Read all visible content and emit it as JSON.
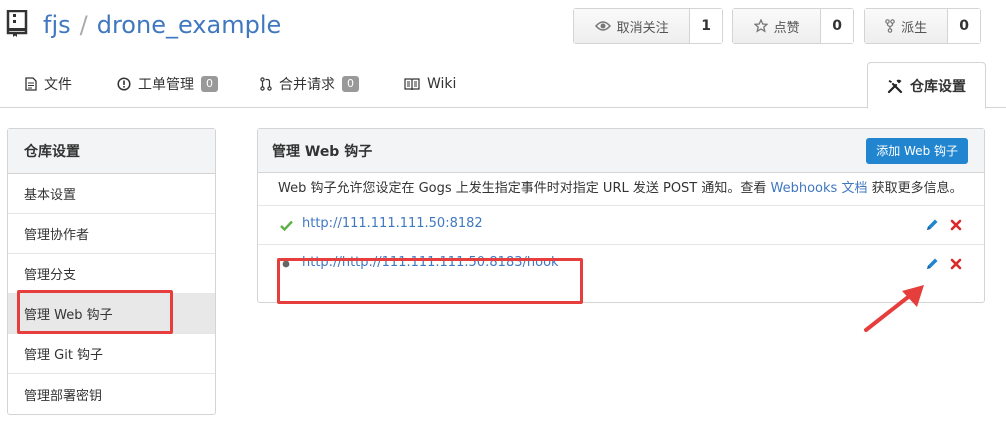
{
  "repo": {
    "owner": "fjs",
    "separator": "/",
    "name": "drone_example"
  },
  "actions": {
    "watch": {
      "label": "取消关注",
      "count": "1",
      "icon": "eye-icon"
    },
    "star": {
      "label": "点赞",
      "count": "0",
      "icon": "star-icon"
    },
    "fork": {
      "label": "派生",
      "count": "0",
      "icon": "fork-icon"
    }
  },
  "tabs": {
    "files": {
      "label": "文件",
      "icon": "file-icon"
    },
    "issues": {
      "label": "工单管理",
      "count": "0",
      "icon": "issue-icon"
    },
    "pulls": {
      "label": "合并请求",
      "count": "0",
      "icon": "pull-request-icon"
    },
    "wiki": {
      "label": "Wiki",
      "icon": "book-icon"
    },
    "settings": {
      "label": "仓库设置",
      "icon": "tools-icon"
    }
  },
  "sidebar": {
    "title": "仓库设置",
    "items": [
      {
        "label": "基本设置"
      },
      {
        "label": "管理协作者"
      },
      {
        "label": "管理分支"
      },
      {
        "label": "管理 Web 钩子"
      },
      {
        "label": "管理 Git 钩子"
      },
      {
        "label": "管理部署密钥"
      }
    ],
    "active_index": 3
  },
  "panel": {
    "title": "管理 Web 钩子",
    "add_button": "添加 Web 钩子",
    "desc_prefix": "Web 钩子允许您设定在 Gogs 上发生指定事件时对指定 URL 发送 POST 通知。查看 ",
    "desc_link": "Webhooks 文档",
    "desc_suffix": " 获取更多信息。"
  },
  "hooks": [
    {
      "url": "http://111.111.111.50:8182",
      "status": "success"
    },
    {
      "url": "http://http://111.111.111.50:8183/hook",
      "status": "unknown"
    }
  ],
  "colors": {
    "link": "#4078c0",
    "primary_button": "#2185d0",
    "success": "#5eb14a",
    "delete": "#db2828",
    "annotation": "#e63d3d"
  }
}
